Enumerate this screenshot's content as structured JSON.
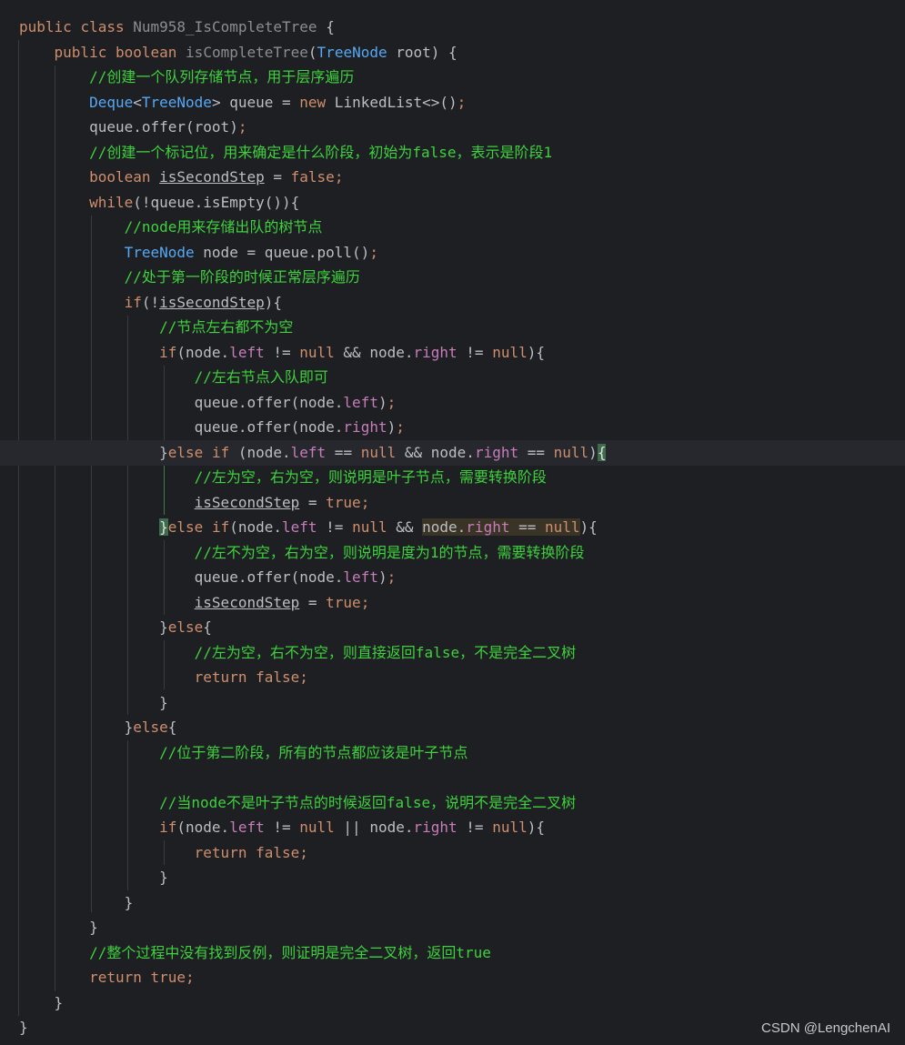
{
  "code": {
    "l1": {
      "kw1": "public",
      "kw2": "class",
      "name": "Num958_IsCompleteTree",
      "brace": "{"
    },
    "l2": {
      "kw1": "public",
      "kw2": "boolean",
      "method": "isCompleteTree",
      "p1": "(",
      "type": "TreeNode",
      "p2": " root) {"
    },
    "l3": {
      "comment": "//创建一个队列存储节点，用于层序遍历"
    },
    "l4": {
      "t1": "Deque",
      "lt": "<",
      "t2": "TreeNode",
      "mid": "> queue = ",
      "kw": "new",
      "rest": " LinkedList<>()",
      "semi": ";"
    },
    "l5": {
      "code": "queue.offer(root)",
      "semi": ";"
    },
    "l6": {
      "comment": "//创建一个标记位，用来确定是什么阶段，初始为false，表示是阶段1"
    },
    "l7": {
      "kw": "boolean",
      "var": "isSecondStep",
      "eq": " = ",
      "val": "false",
      "semi": ";"
    },
    "l8": {
      "kw": "while",
      "rest": "(!queue.isEmpty()){"
    },
    "l9": {
      "comment": "//node用来存储出队的树节点"
    },
    "l10": {
      "type": "TreeNode",
      "rest": " node = queue.poll()",
      "semi": ";"
    },
    "l11": {
      "comment": "//处于第一阶段的时候正常层序遍历"
    },
    "l12": {
      "kw": "if",
      "p": "(!",
      "var": "isSecondStep",
      "end": "){"
    },
    "l13": {
      "comment": "//节点左右都不为空"
    },
    "l14": {
      "kw": "if",
      "a": "(node.",
      "f1": "left",
      "b": " != ",
      "n1": "null",
      "c": " && node.",
      "f2": "right",
      "d": " != ",
      "n2": "null",
      "e": "){"
    },
    "l15": {
      "comment": "//左右节点入队即可"
    },
    "l16": {
      "a": "queue.offer(node.",
      "f": "left",
      "b": ")",
      "semi": ";"
    },
    "l17": {
      "a": "queue.offer(node.",
      "f": "right",
      "b": ")",
      "semi": ";"
    },
    "l18": {
      "a": "}",
      "kw1": "else",
      "kw2": "if",
      "b": " (node.",
      "f1": "left",
      "c": " == ",
      "n1": "null",
      "d": " && node.",
      "f2": "right",
      "e": " == ",
      "n2": "null",
      "g": ")",
      "brace": "{"
    },
    "l19": {
      "comment": "//左为空，右为空，则说明是叶子节点，需要转换阶段"
    },
    "l20": {
      "var": "isSecondStep",
      "eq": " = ",
      "val": "true",
      "semi": ";"
    },
    "l21": {
      "brace": "}",
      "kw1": "else",
      "kw2": "if",
      "a": "(node.",
      "f1": "left",
      "b": " != ",
      "n1": "null",
      "c": " && ",
      "d": "node.",
      "f2": "right",
      "e": " == ",
      "n2": "null",
      "g": "){"
    },
    "l22": {
      "comment": "//左不为空，右为空，则说明是度为1的节点，需要转换阶段"
    },
    "l23": {
      "a": "queue.offer(node.",
      "f": "left",
      "b": ")",
      "semi": ";"
    },
    "l24": {
      "var": "isSecondStep",
      "eq": " = ",
      "val": "true",
      "semi": ";"
    },
    "l25": {
      "a": "}",
      "kw": "else",
      "b": "{"
    },
    "l26": {
      "comment": "//左为空，右不为空，则直接返回false，不是完全二叉树"
    },
    "l27": {
      "kw": "return",
      "val": "false",
      "semi": ";"
    },
    "l28": {
      "text": "}"
    },
    "l29": {
      "a": "}",
      "kw": "else",
      "b": "{"
    },
    "l30": {
      "comment": "//位于第二阶段，所有的节点都应该是叶子节点"
    },
    "l32": {
      "comment": "//当node不是叶子节点的时候返回false，说明不是完全二叉树"
    },
    "l33": {
      "kw": "if",
      "a": "(node.",
      "f1": "left",
      "b": " != ",
      "n1": "null",
      "c": " || node.",
      "f2": "right",
      "d": " != ",
      "n2": "null",
      "e": "){"
    },
    "l34": {
      "kw": "return",
      "val": "false",
      "semi": ";"
    },
    "l35": {
      "text": "}"
    },
    "l36": {
      "text": "}"
    },
    "l37": {
      "text": "}"
    },
    "l38": {
      "comment": "//整个过程中没有找到反例，则证明是完全二叉树，返回true"
    },
    "l39": {
      "kw": "return",
      "val": "true",
      "semi": ";"
    },
    "l40": {
      "text": "}"
    },
    "l41": {
      "text": "}"
    }
  },
  "watermark": "CSDN @LengchenAI"
}
